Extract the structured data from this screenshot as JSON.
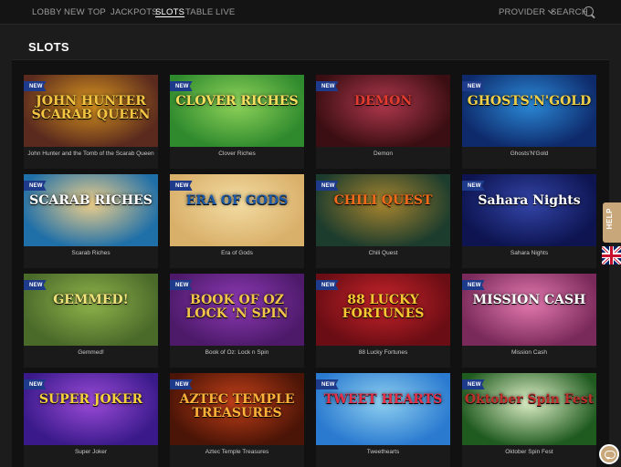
{
  "nav": {
    "items": [
      "LOBBY",
      "NEW",
      "TOP",
      "JACKPOTS",
      "SLOTS",
      "TABLE",
      "LIVE"
    ],
    "active": "SLOTS",
    "provider_label": "PROVIDER",
    "search_label": "SEARCH"
  },
  "page": {
    "title": "SLOTS"
  },
  "badge_label": "NEW",
  "games": [
    {
      "name": "John Hunter and the Tomb of the Scarab Queen",
      "logo": "JOHN HUNTER SCARAB QUEEN",
      "badge": "NEW",
      "bg": "#5a2a1e",
      "bg2": "#d7941f",
      "logo_color": "#f4c542"
    },
    {
      "name": "Clover Riches",
      "logo": "CLOVER RICHES",
      "badge": "NEW",
      "bg": "#2f8a2d",
      "bg2": "#8fd35a",
      "logo_color": "#f6e05e"
    },
    {
      "name": "Demon",
      "logo": "DEMON",
      "badge": "NEW",
      "bg": "#3a0e12",
      "bg2": "#b0384d",
      "logo_color": "#e33b2e"
    },
    {
      "name": "Ghosts'N'Gold",
      "logo": "GHOSTS'N'GOLD",
      "badge": "NEW",
      "bg": "#0e2a6b",
      "bg2": "#2b8ad8",
      "logo_color": "#f2d14a"
    },
    {
      "name": "Scarab Riches",
      "logo": "SCARAB RICHES",
      "badge": "NEW",
      "bg": "#1f6fa8",
      "bg2": "#f0d08a",
      "logo_color": "#ffffff"
    },
    {
      "name": "Era of Gods",
      "logo": "ERA OF GODS",
      "badge": "NEW",
      "bg": "#d9b06a",
      "bg2": "#f3dca3",
      "logo_color": "#1d5ba8"
    },
    {
      "name": "Chili Quest",
      "logo": "CHILI QUEST",
      "badge": "NEW",
      "bg": "#1c3c2d",
      "bg2": "#a8852e",
      "logo_color": "#f06a1a"
    },
    {
      "name": "Sahara Nights",
      "logo": "Sahara Nights",
      "badge": "NEW",
      "bg": "#0d1450",
      "bg2": "#3345a8",
      "logo_color": "#ffffff"
    },
    {
      "name": "Gemmed!",
      "logo": "GEMMED!",
      "badge": "NEW",
      "bg": "#4a6a2a",
      "bg2": "#8fb34a",
      "logo_color": "#f1e37b"
    },
    {
      "name": "Book of Oz: Lock n Spin",
      "logo": "BOOK OF OZ LOCK 'N SPIN",
      "badge": "NEW",
      "bg": "#4d1a6a",
      "bg2": "#8e3ab5",
      "logo_color": "#f2c54a"
    },
    {
      "name": "88 Lucky Fortunes",
      "logo": "88 LUCKY FORTUNES",
      "badge": "NEW",
      "bg": "#6a0d14",
      "bg2": "#c9242b",
      "logo_color": "#f7c832"
    },
    {
      "name": "Mission Cash",
      "logo": "MISSION CASH",
      "badge": "NEW",
      "bg": "#7a2a5a",
      "bg2": "#e57ab0",
      "logo_color": "#ffffff"
    },
    {
      "name": "Super Joker",
      "logo": "SUPER JOKER",
      "badge": "NEW",
      "bg": "#3a1a8a",
      "bg2": "#9b4bd8",
      "logo_color": "#f7d23a"
    },
    {
      "name": "Aztec Temple Treasures",
      "logo": "AZTEC TEMPLE TREASURES",
      "badge": "NEW",
      "bg": "#4a1406",
      "bg2": "#c4401a",
      "logo_color": "#ffb23a"
    },
    {
      "name": "Tweethearts",
      "logo": "TWEET HEARTS",
      "badge": "NEW",
      "bg": "#2a7ad0",
      "bg2": "#8fd0f0",
      "logo_color": "#e8304a"
    },
    {
      "name": "Oktober Spin Fest",
      "logo": "Oktober Spin Fest",
      "badge": "NEW",
      "bg": "#1f5a1f",
      "bg2": "#dff0c8",
      "logo_color": "#c0302a"
    }
  ],
  "side": {
    "help_label": "HELP",
    "language_flag": "uk-flag-icon",
    "chat_icon": "chat-bubble-icon",
    "accent": "#c8a77b"
  },
  "colors": {
    "background": "#1c1c1c",
    "panel": "#111111",
    "badge": "#1e3a8a"
  }
}
